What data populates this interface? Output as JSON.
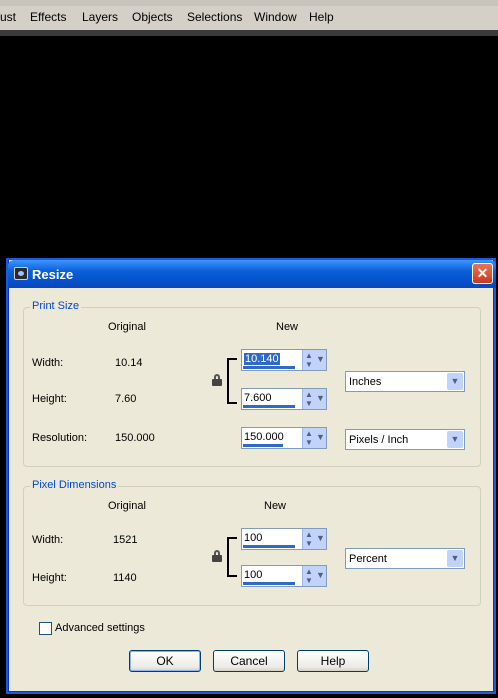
{
  "menubar": {
    "items": [
      "ust",
      "Effects",
      "Layers",
      "Objects",
      "Selections",
      "Window",
      "Help"
    ]
  },
  "dialog": {
    "title": "Resize",
    "close_glyph": "✕",
    "print_size": {
      "legend": "Print Size",
      "col_original": "Original",
      "col_new": "New",
      "width_label": "Width:",
      "width_original": "10.14",
      "width_new": "10.140",
      "height_label": "Height:",
      "height_original": "7.60",
      "height_new": "7.600",
      "units": "Inches",
      "resolution_label": "Resolution:",
      "resolution_original": "150.000",
      "resolution_new": "150.000",
      "resolution_units": "Pixels / Inch"
    },
    "pixel_dimensions": {
      "legend": "Pixel Dimensions",
      "col_original": "Original",
      "col_new": "New",
      "width_label": "Width:",
      "width_original": "1521",
      "width_new": "100",
      "height_label": "Height:",
      "height_original": "1140",
      "height_new": "100",
      "units": "Percent"
    },
    "advanced_label": "Advanced settings",
    "buttons": {
      "ok": "OK",
      "cancel": "Cancel",
      "help": "Help"
    }
  },
  "icons": [
    "app-icon",
    "lock-icon",
    "spin-up-icon",
    "spin-down-icon",
    "dropdown-arrow-icon",
    "close-icon"
  ],
  "colors": {
    "titlebar": "#0a5fd8",
    "dialog_bg": "#ece9d8",
    "legend": "#0046d5",
    "close": "#c8391d"
  }
}
